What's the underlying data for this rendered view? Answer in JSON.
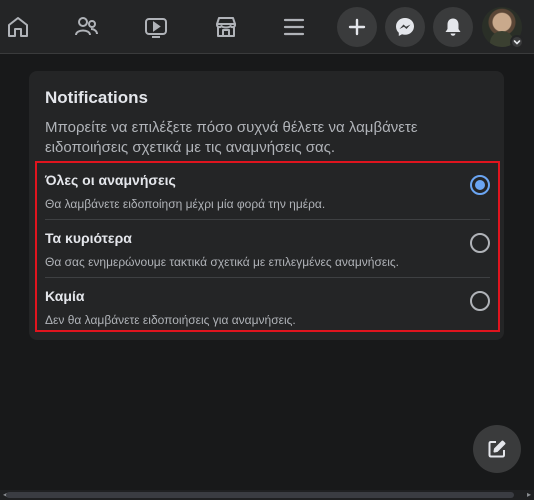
{
  "nav": {
    "icons": [
      "home-icon",
      "friends-icon",
      "watch-icon",
      "marketplace-icon",
      "menu-icon"
    ],
    "actions": [
      "create-icon",
      "messenger-icon",
      "notifications-icon"
    ]
  },
  "card": {
    "title": "Notifications",
    "description": "Μπορείτε να επιλέξετε πόσο συχνά θέλετε να λαμβάνετε ειδοποιήσεις σχετικά με τις αναμνήσεις σας."
  },
  "options": [
    {
      "label": "Όλες οι αναμνήσεις",
      "sublabel": "Θα λαμβάνετε ειδοποίηση μέχρι μία φορά την ημέρα.",
      "selected": true
    },
    {
      "label": "Τα κυριότερα",
      "sublabel": "Θα σας ενημερώνουμε τακτικά σχετικά με επιλεγμένες αναμνήσεις.",
      "selected": false
    },
    {
      "label": "Καμία",
      "sublabel": "Δεν θα λαμβάνετε ειδοποιήσεις για αναμνήσεις.",
      "selected": false
    }
  ],
  "colors": {
    "background": "#18191a",
    "surface": "#242526",
    "radio_selected": "#6ba5f2",
    "highlight_border": "#e0141e"
  },
  "fab_icon": "compose-icon"
}
